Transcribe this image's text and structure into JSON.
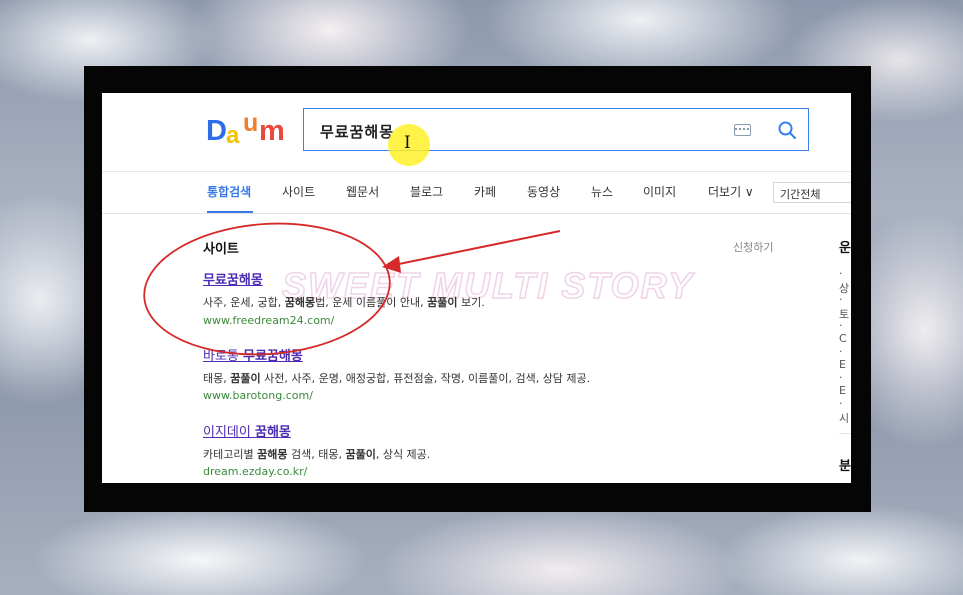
{
  "search": {
    "query": "무료꿈해몽"
  },
  "tabs": [
    "통합검색",
    "사이트",
    "웹문서",
    "블로그",
    "카페",
    "동영상",
    "뉴스",
    "이미지",
    "더보기 ∨"
  ],
  "period_filter": "기간전체",
  "site_section": {
    "title": "사이트",
    "apply_link": "신청하기",
    "results": [
      {
        "title_prefix": "",
        "title_bold": "무료꿈해몽",
        "desc_parts": [
          "사주, 운세, 궁합, ",
          "꿈해몽",
          "법, 운세 이름풀이 안내, ",
          "꿈풀이",
          " 보기."
        ],
        "url": "www.freedream24.com/"
      },
      {
        "title_prefix": "바로통 ",
        "title_bold": "무료꿈해몽",
        "desc_parts": [
          "태몽, ",
          "꿈풀이",
          " 사전, 사주, 운명, 애정궁합, 퓨전점술, 작명, 이름풀이, 검색, 상담 제공."
        ],
        "url": "www.barotong.com/"
      },
      {
        "title_prefix": "이지데이 ",
        "title_bold": "꿈해몽",
        "desc_parts": [
          "카테고리별 ",
          "꿈해몽",
          " 검색, 태몽, ",
          "꿈풀이",
          ", 상식 제공."
        ],
        "url": "dream.ezday.co.kr/"
      }
    ]
  },
  "right_column": {
    "title": "운",
    "items": [
      "· 상",
      "· 토",
      "· C",
      "· E",
      "· E",
      "· 시"
    ],
    "title2": "분"
  },
  "watermark": "SWEET MULTI STORY",
  "annotation_colors": {
    "circle": "#d62a2a",
    "arrow": "#d62a2a"
  }
}
